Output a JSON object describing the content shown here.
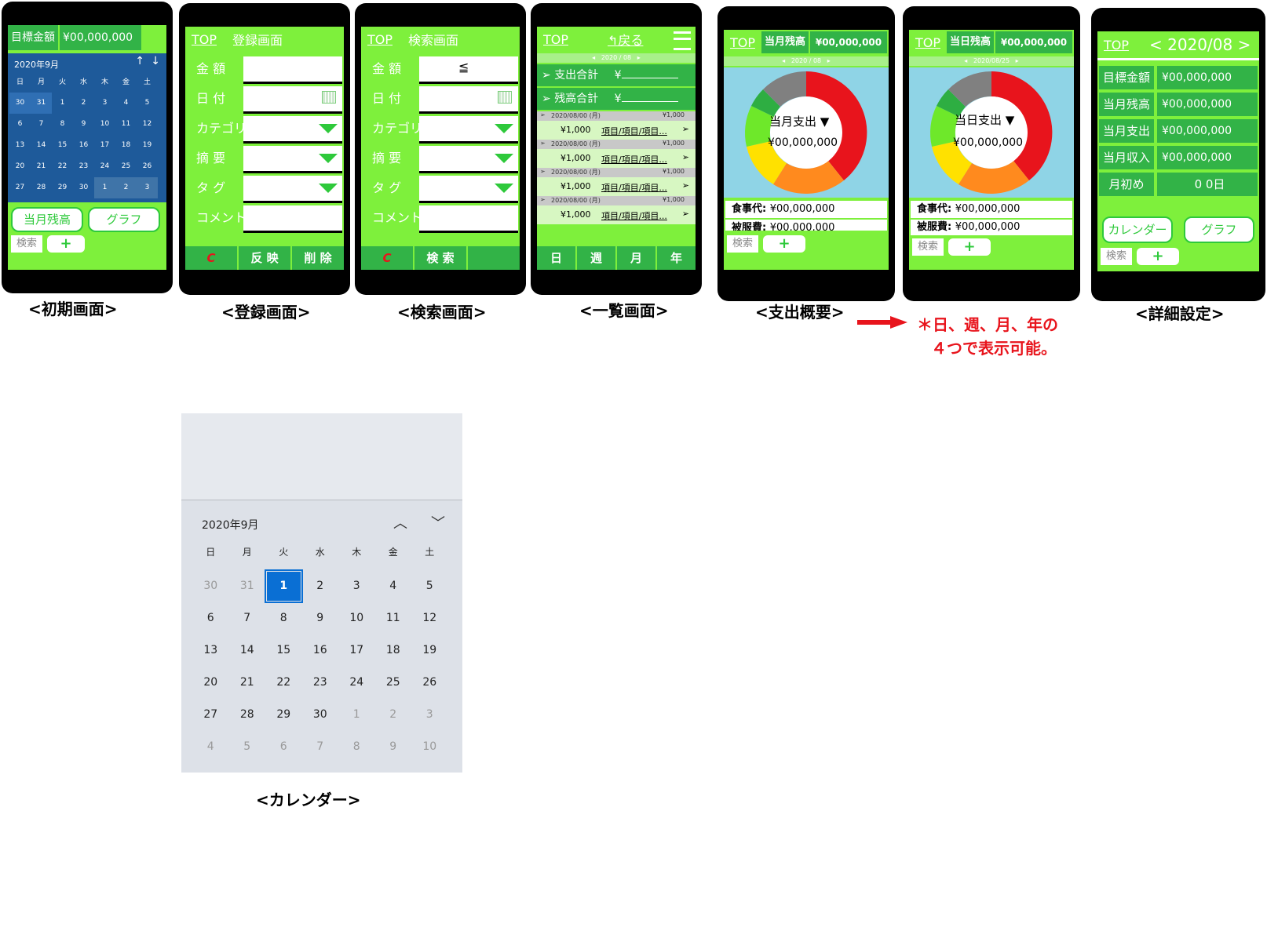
{
  "screens": {
    "initial": {
      "caption": "<初期画面>",
      "target_label": "目標金額",
      "target_value": "¥00,000,000",
      "month": "2020年9月",
      "weekdays": [
        "日",
        "月",
        "火",
        "水",
        "木",
        "金",
        "土"
      ],
      "days": [
        "30",
        "31",
        "1",
        "2",
        "3",
        "4",
        "5",
        "6",
        "7",
        "8",
        "9",
        "10",
        "11",
        "12",
        "13",
        "14",
        "15",
        "16",
        "17",
        "18",
        "19",
        "20",
        "21",
        "22",
        "23",
        "24",
        "25",
        "26",
        "27",
        "28",
        "29",
        "30",
        "1",
        "2",
        "3"
      ],
      "btn_balance": "当月残高",
      "btn_graph": "グラフ",
      "search": "検索",
      "plus": "+"
    },
    "register": {
      "caption": "<登録画面>",
      "top": "TOP",
      "title": "登録画面",
      "fields": [
        "金 額",
        "日 付",
        "カテゴリ",
        "摘 要",
        "タ グ",
        "コメント"
      ],
      "btn_c": "C",
      "btn_apply": "反 映",
      "btn_delete": "削 除"
    },
    "search": {
      "caption": "<検索画面>",
      "top": "TOP",
      "title": "検索画面",
      "fields": [
        "金 額",
        "日 付",
        "カテゴリ",
        "摘 要",
        "タ グ",
        "コメント"
      ],
      "btn_c": "C",
      "btn_search": "検 索"
    },
    "list": {
      "caption": "<一覧画面>",
      "top": "TOP",
      "back": "戻る",
      "month_nav": "2020 / 08",
      "total_expense": "支出合計",
      "total_balance": "残高合計",
      "yen": "¥",
      "rows": [
        {
          "date": "2020/08/00 (月)",
          "amount": "¥1,000",
          "item": "項目/項目/項目..."
        },
        {
          "date": "2020/08/00 (月)",
          "amount": "¥1,000",
          "item": "項目/項目/項目..."
        },
        {
          "date": "2020/08/00 (月)",
          "amount": "¥1,000",
          "item": "項目/項目/項目..."
        },
        {
          "date": "2020/08/00 (月)",
          "amount": "¥1,000",
          "item": "項目/項目/項目..."
        }
      ],
      "row_amount_small": "¥1,000",
      "tabs": [
        "日",
        "週",
        "月",
        "年"
      ]
    },
    "expense": {
      "caption": "<支出概要>",
      "top": "TOP",
      "balance_label": "当月残高",
      "balance_value": "¥00,000,000",
      "month_nav": "2020 / 08",
      "center_label": "当月支出",
      "center_value": "¥00,000,000",
      "items": [
        {
          "label": "食事代:",
          "value": "¥00,000,000"
        },
        {
          "label": "被服費:",
          "value": "¥00,000,000"
        }
      ],
      "search": "検索",
      "plus": "+"
    },
    "expense_day": {
      "top": "TOP",
      "balance_label": "当日残高",
      "balance_value": "¥00,000,000",
      "date_nav": "2020/08/25",
      "center_label": "当日支出",
      "center_value": "¥00,000,000",
      "items": [
        {
          "label": "食事代:",
          "value": "¥00,000,000"
        },
        {
          "label": "被服費:",
          "value": "¥00,000,000"
        }
      ],
      "search": "検索",
      "plus": "+"
    },
    "settings": {
      "caption": "<詳細設定>",
      "top": "TOP",
      "month": "< 2020/08 >",
      "rows": [
        {
          "label": "目標金額",
          "value": "¥00,000,000"
        },
        {
          "label": "当月残高",
          "value": "¥00,000,000"
        },
        {
          "label": "当月支出",
          "value": "¥00,000,000"
        },
        {
          "label": "当月収入",
          "value": "¥00,000,000"
        },
        {
          "label": "月初め",
          "value": "0 0日"
        }
      ],
      "btn_calendar": "カレンダー",
      "btn_graph": "グラフ",
      "search": "検索",
      "plus": "+"
    }
  },
  "note_line1": "＊日、週、月、年の",
  "note_line2": "４つで表示可能。",
  "calendar": {
    "caption": "<カレンダー>",
    "month": "2020年9月",
    "weekdays": [
      "日",
      "月",
      "火",
      "水",
      "木",
      "金",
      "土"
    ],
    "days": [
      "30",
      "31",
      "1",
      "2",
      "3",
      "4",
      "5",
      "6",
      "7",
      "8",
      "9",
      "10",
      "11",
      "12",
      "13",
      "14",
      "15",
      "16",
      "17",
      "18",
      "19",
      "20",
      "21",
      "22",
      "23",
      "24",
      "25",
      "26",
      "27",
      "28",
      "29",
      "30",
      "1",
      "2",
      "3",
      "4",
      "5",
      "6",
      "7",
      "8",
      "9",
      "10"
    ],
    "selected": "1"
  },
  "colors": {
    "green_light": "#7ef03c",
    "green_dark": "#32b347",
    "accent_red": "#e8141c",
    "selected_blue": "#0a6fd4"
  }
}
